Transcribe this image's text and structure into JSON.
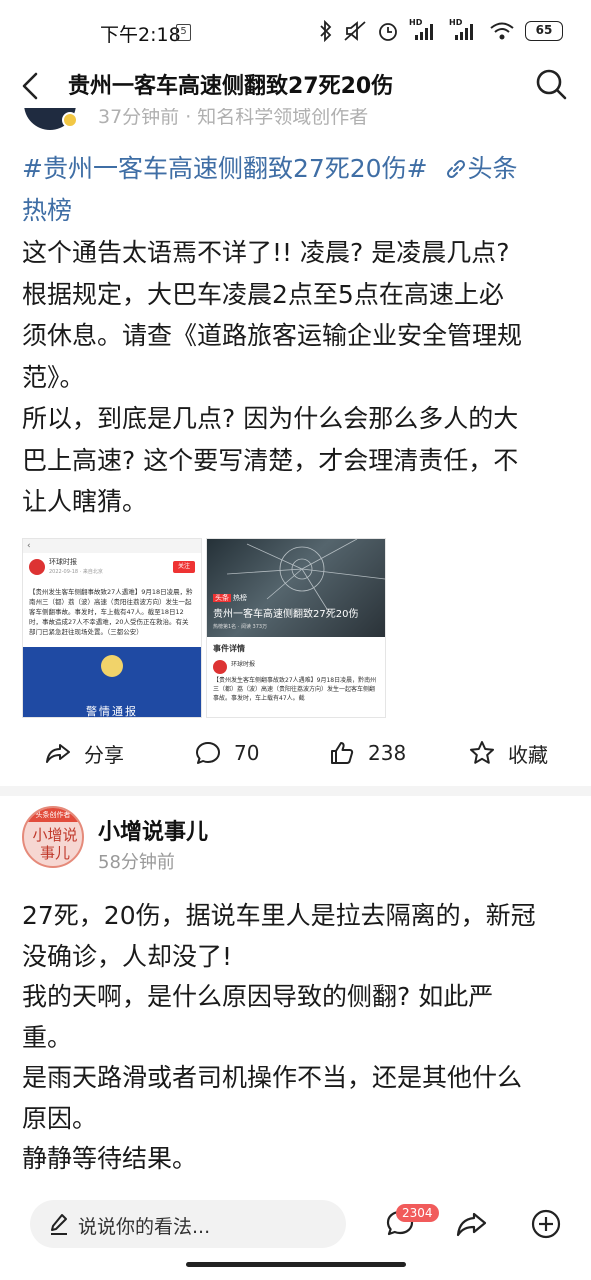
{
  "status_bar": {
    "time": "下午2:18",
    "time_icon": "5",
    "battery": "65",
    "icons": [
      "bluetooth-icon",
      "mute-icon",
      "alarm-icon",
      "signal-hd-icon",
      "signal-hd-icon",
      "wifi-icon"
    ],
    "hd1": "HD",
    "hd2": "HD"
  },
  "header": {
    "title": "贵州一客车高速侧翻致27死20伤",
    "back_icon": "back-arrow-icon",
    "search_icon": "search-icon"
  },
  "peek_author": {
    "text": "37分钟前 · 知名科学领域创作者"
  },
  "post": {
    "hashtag": "#贵州一客车高速侧翻致27死20伤#",
    "hotlist_label": "头条",
    "hotlist_label2": "热榜",
    "paragraphs": [
      "这个通告太语焉不详了!! 凌晨? 是凌晨几点?",
      "根据规定，大巴车凌晨2点至5点在高速上必",
      "须休息。请查《道路旅客运输企业安全管理规",
      "范》。",
      "所以，到底是几点? 因为什么会那么多人的大",
      "巴上高速? 这个要写清楚，才会理清责任，不",
      "让人瞎猜。"
    ]
  },
  "thumb1": {
    "back": "‹",
    "name": "环球时报",
    "meta": "2022-09-18 · 来自北京",
    "follow": "关注",
    "body": "【贵州发生客车侧翻事故致27人遇难】9月18日凌晨，黔南州三（都）荔（波）高速（贵阳往荔波方向）发生一起客车侧翻事故。事发时，车上载有47人。截至18日12时，事故造成27人不幸遇难，20人受伤正在救治。有关部门已紧急赶往现场处置。（三都公安）",
    "banner": "警情通报"
  },
  "thumb2": {
    "tag": "头条",
    "tag2": "热榜",
    "title": "贵州一客车高速侧翻致27死20伤",
    "sub": "热榜第1名 · 阅读 373万",
    "section": "事件详情",
    "name": "环球时报",
    "text": "【贵州发生客车侧翻事故致27人遇难】9月18日凌晨，黔南州三（都）荔（波）高速（贵阳往荔波方向）发生一起客车侧翻事故。事发时，车上载有47人。截"
  },
  "actions": {
    "share": "分享",
    "comments": "70",
    "likes": "238",
    "favorite": "收藏"
  },
  "comment": {
    "avatar_ribbon": "头条创作者",
    "avatar_text": "小增说事儿",
    "name": "小增说事儿",
    "time": "58分钟前",
    "lines": [
      "27死，20伤，据说车里人是拉去隔离的，新冠",
      "没确诊，人却没了!",
      "我的天啊，是什么原因导致的侧翻? 如此严",
      "重。",
      "是雨天路滑或者司机操作不当，还是其他什么",
      "原因。",
      "静静等待结果。"
    ]
  },
  "bottom_bar": {
    "placeholder": "说说你的看法...",
    "comment_count": "2304"
  }
}
